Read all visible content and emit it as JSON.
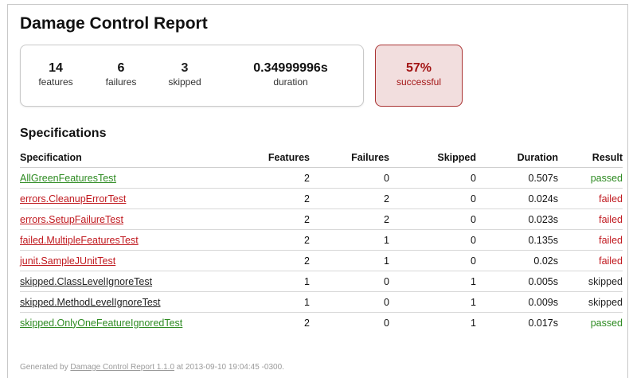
{
  "title": "Damage Control Report",
  "summary": {
    "features": {
      "value": "14",
      "label": "features"
    },
    "failures": {
      "value": "6",
      "label": "failures"
    },
    "skipped": {
      "value": "3",
      "label": "skipped"
    },
    "duration": {
      "value": "0.34999996s",
      "label": "duration"
    },
    "success": {
      "value": "57%",
      "label": "successful"
    }
  },
  "section_title": "Specifications",
  "table": {
    "headers": {
      "specification": "Specification",
      "features": "Features",
      "failures": "Failures",
      "skipped": "Skipped",
      "duration": "Duration",
      "result": "Result"
    },
    "rows": [
      {
        "name": "AllGreenFeaturesTest",
        "features": "2",
        "failures": "0",
        "skipped": "0",
        "duration": "0.507s",
        "result": "passed"
      },
      {
        "name": "errors.CleanupErrorTest",
        "features": "2",
        "failures": "2",
        "skipped": "0",
        "duration": "0.024s",
        "result": "failed"
      },
      {
        "name": "errors.SetupFailureTest",
        "features": "2",
        "failures": "2",
        "skipped": "0",
        "duration": "0.023s",
        "result": "failed"
      },
      {
        "name": "failed.MultipleFeaturesTest",
        "features": "2",
        "failures": "1",
        "skipped": "0",
        "duration": "0.135s",
        "result": "failed"
      },
      {
        "name": "junit.SampleJUnitTest",
        "features": "2",
        "failures": "1",
        "skipped": "0",
        "duration": "0.02s",
        "result": "failed"
      },
      {
        "name": "skipped.ClassLevelIgnoreTest",
        "features": "1",
        "failures": "0",
        "skipped": "1",
        "duration": "0.005s",
        "result": "skipped"
      },
      {
        "name": "skipped.MethodLevelIgnoreTest",
        "features": "1",
        "failures": "0",
        "skipped": "1",
        "duration": "0.009s",
        "result": "skipped"
      },
      {
        "name": "skipped.OnlyOneFeatureIgnoredTest",
        "features": "2",
        "failures": "0",
        "skipped": "1",
        "duration": "0.017s",
        "result": "passed"
      }
    ]
  },
  "footer": {
    "prefix": "Generated by",
    "link": "Damage Control Report 1.1.0",
    "suffix": "at 2013-09-10 19:04:45 -0300."
  },
  "colors": {
    "passed": "#2e8b22",
    "failed": "#c0181e",
    "skipped": "#222222",
    "success_box_bg": "#f2dede",
    "success_box_text": "#a31515"
  }
}
